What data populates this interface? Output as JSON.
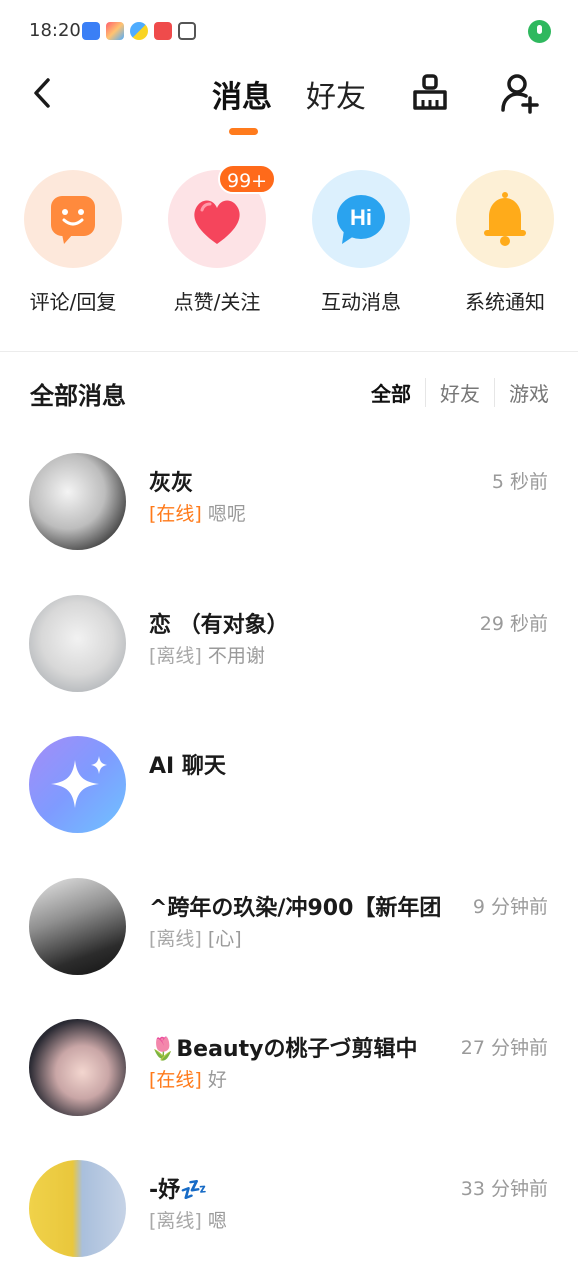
{
  "status_bar": {
    "time": "18:20",
    "icons": [
      "app-notification-icon",
      "app-store-icon",
      "pinwheel-icon",
      "mail-icon",
      "hand-icon"
    ],
    "mic_color": "#2fb85e"
  },
  "nav": {
    "tabs": [
      {
        "label": "消息",
        "active": true
      },
      {
        "label": "好友",
        "active": false
      }
    ],
    "indicator_color": "#ff7b1d"
  },
  "categories": [
    {
      "label": "评论/回复",
      "icon": "smile-chat-icon",
      "bg": "#fde8db",
      "fg": "#ff8a3d"
    },
    {
      "label": "点赞/关注",
      "icon": "heart-icon",
      "bg": "#fde3e6",
      "fg": "#f5455c",
      "badge": "99+"
    },
    {
      "label": "互动消息",
      "icon": "hi-bubble-icon",
      "bg": "#dcf0fd",
      "fg": "#2aa3ef"
    },
    {
      "label": "系统通知",
      "icon": "bell-icon",
      "bg": "#fdf0d6",
      "fg": "#ffab1a"
    }
  ],
  "section": {
    "title": "全部消息",
    "filters": [
      "全部",
      "好友",
      "游戏"
    ],
    "active_filter": "全部"
  },
  "messages": [
    {
      "name": "灰灰",
      "time": "5 秒前",
      "status": "[在线]",
      "online": true,
      "text": "嗯呢"
    },
    {
      "name": "恋 （有对象）",
      "time": "29 秒前",
      "status": "[离线]",
      "online": false,
      "text": "不用谢"
    },
    {
      "name": "AI 聊天",
      "time": "",
      "status": "",
      "online": false,
      "text": ""
    },
    {
      "name": "^跨年の玖染/冲900【新年团",
      "time": "9 分钟前",
      "status": "[离线]",
      "online": false,
      "text": "[心]"
    },
    {
      "name": "🌷Beautyの桃子づ剪辑中",
      "time": "27 分钟前",
      "status": "[在线]",
      "online": true,
      "text": "好"
    },
    {
      "name": "-妤💤",
      "time": "33 分钟前",
      "status": "[离线]",
      "online": false,
      "text": "嗯"
    }
  ]
}
